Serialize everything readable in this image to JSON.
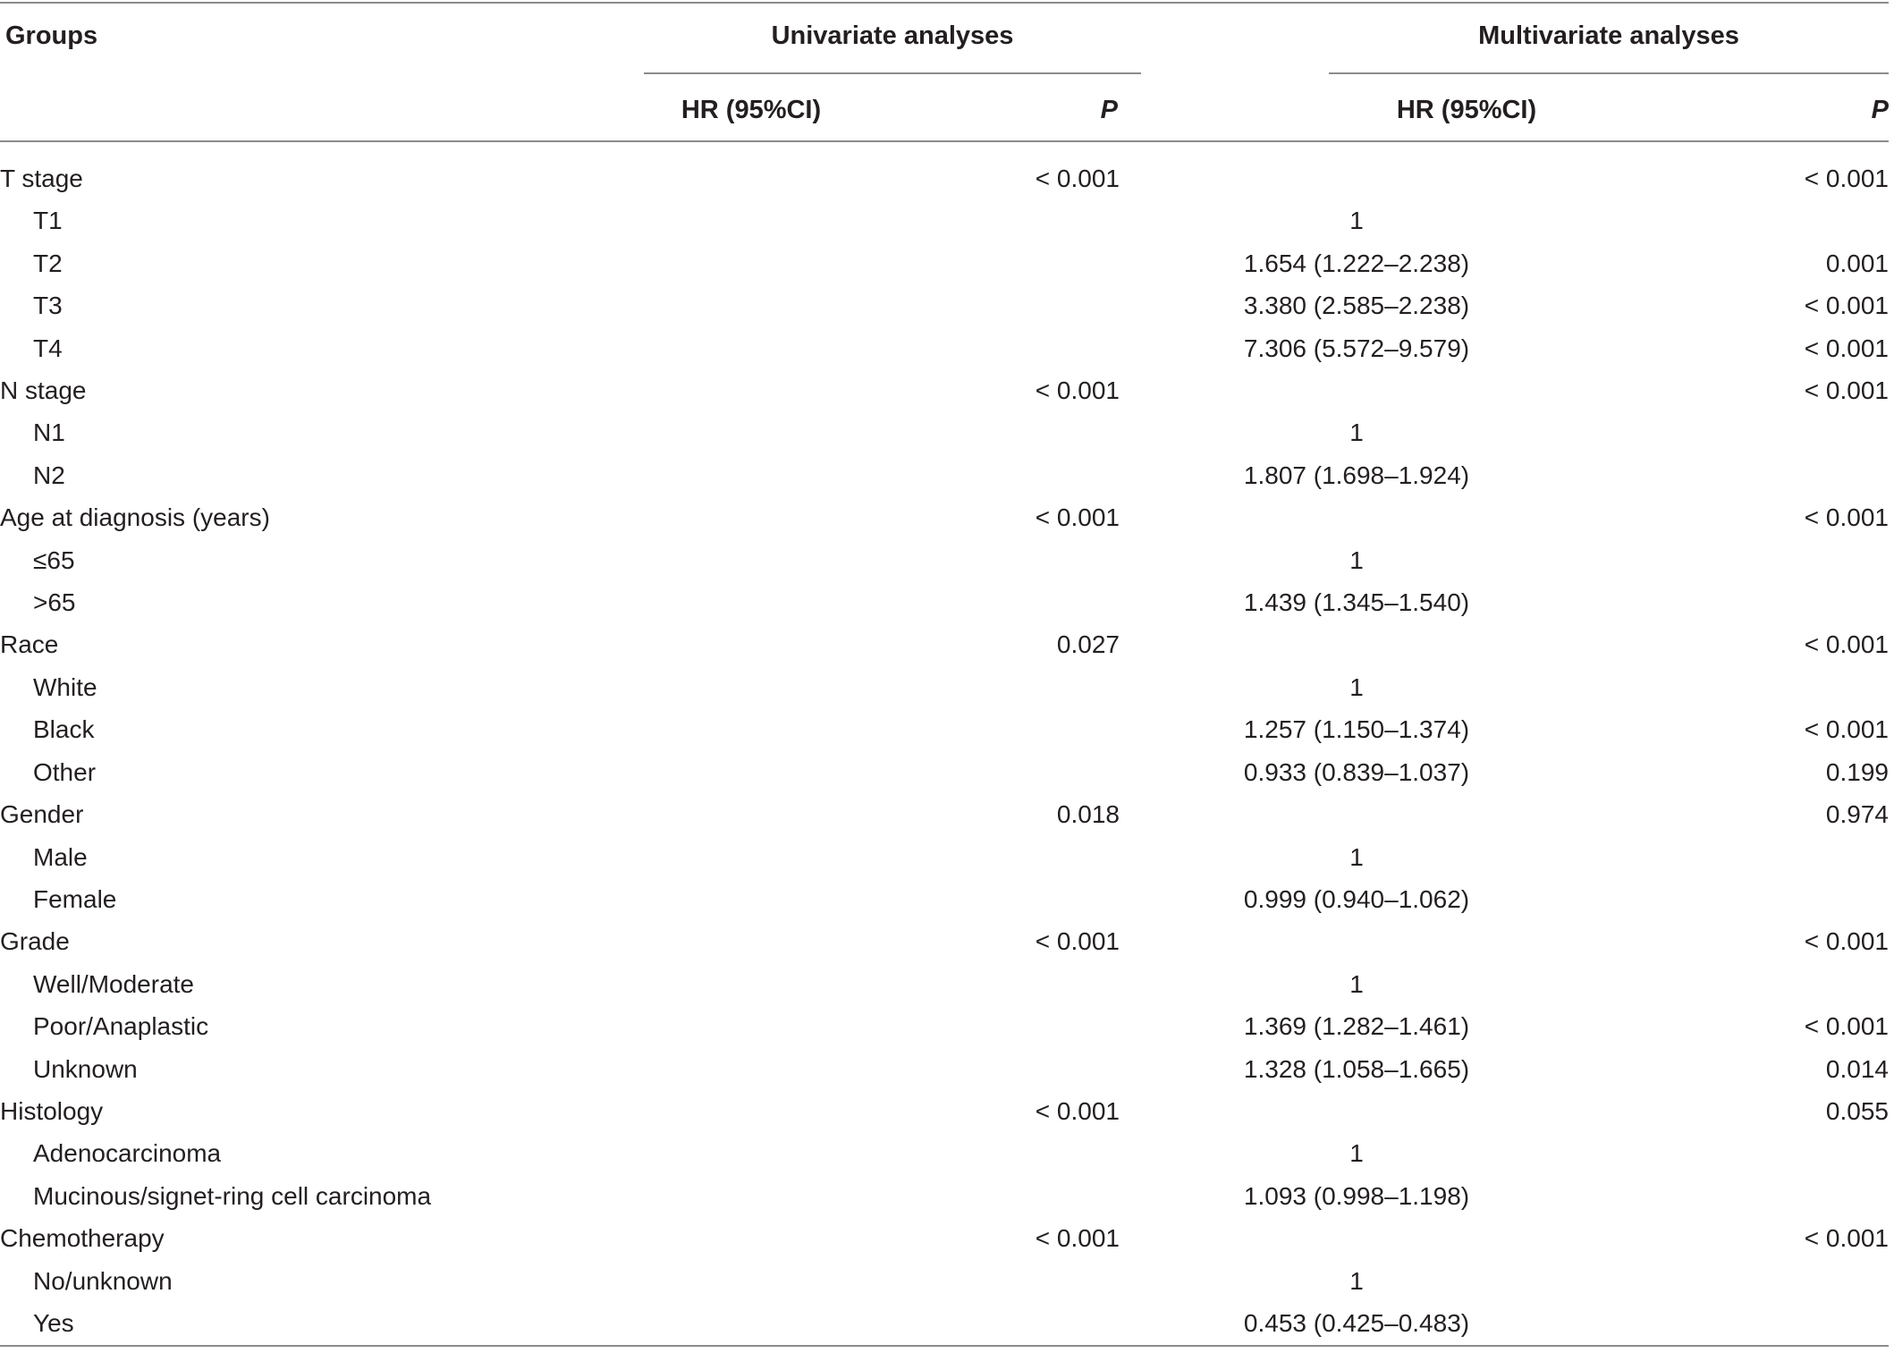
{
  "header": {
    "groups": "Groups",
    "univariate": "Univariate analyses",
    "multivariate": "Multivariate analyses",
    "hr_col": "HR (95%CI)",
    "p_col": "P"
  },
  "rows": [
    {
      "label": "T stage",
      "sub": false,
      "uhr": "",
      "up": "< 0.001",
      "mhr": "",
      "mp": "< 0.001"
    },
    {
      "label": "T1",
      "sub": true,
      "uhr": "",
      "up": "",
      "mhr": "1",
      "mp": ""
    },
    {
      "label": "T2",
      "sub": true,
      "uhr": "",
      "up": "",
      "mhr": "1.654 (1.222–2.238)",
      "mp": "0.001"
    },
    {
      "label": "T3",
      "sub": true,
      "uhr": "",
      "up": "",
      "mhr": "3.380 (2.585–2.238)",
      "mp": "< 0.001"
    },
    {
      "label": "T4",
      "sub": true,
      "uhr": "",
      "up": "",
      "mhr": "7.306 (5.572–9.579)",
      "mp": "< 0.001"
    },
    {
      "label": "N stage",
      "sub": false,
      "uhr": "",
      "up": "< 0.001",
      "mhr": "",
      "mp": "< 0.001"
    },
    {
      "label": "N1",
      "sub": true,
      "uhr": "",
      "up": "",
      "mhr": "1",
      "mp": ""
    },
    {
      "label": "N2",
      "sub": true,
      "uhr": "",
      "up": "",
      "mhr": "1.807 (1.698–1.924)",
      "mp": ""
    },
    {
      "label": "Age at diagnosis (years)",
      "sub": false,
      "uhr": "",
      "up": "< 0.001",
      "mhr": "",
      "mp": "< 0.001"
    },
    {
      "label": "≤65",
      "sub": true,
      "uhr": "",
      "up": "",
      "mhr": "1",
      "mp": ""
    },
    {
      "label": ">65",
      "sub": true,
      "uhr": "",
      "up": "",
      "mhr": "1.439 (1.345–1.540)",
      "mp": ""
    },
    {
      "label": "Race",
      "sub": false,
      "uhr": "",
      "up": "0.027",
      "mhr": "",
      "mp": "< 0.001"
    },
    {
      "label": "White",
      "sub": true,
      "uhr": "",
      "up": "",
      "mhr": "1",
      "mp": ""
    },
    {
      "label": "Black",
      "sub": true,
      "uhr": "",
      "up": "",
      "mhr": "1.257 (1.150–1.374)",
      "mp": "< 0.001"
    },
    {
      "label": "Other",
      "sub": true,
      "uhr": "",
      "up": "",
      "mhr": "0.933 (0.839–1.037)",
      "mp": "0.199"
    },
    {
      "label": "Gender",
      "sub": false,
      "uhr": "",
      "up": "0.018",
      "mhr": "",
      "mp": "0.974"
    },
    {
      "label": "Male",
      "sub": true,
      "uhr": "",
      "up": "",
      "mhr": "1",
      "mp": ""
    },
    {
      "label": "Female",
      "sub": true,
      "uhr": "",
      "up": "",
      "mhr": "0.999 (0.940–1.062)",
      "mp": ""
    },
    {
      "label": "Grade",
      "sub": false,
      "uhr": "",
      "up": "< 0.001",
      "mhr": "",
      "mp": "< 0.001"
    },
    {
      "label": "Well/Moderate",
      "sub": true,
      "uhr": "",
      "up": "",
      "mhr": "1",
      "mp": ""
    },
    {
      "label": "Poor/Anaplastic",
      "sub": true,
      "uhr": "",
      "up": "",
      "mhr": "1.369 (1.282–1.461)",
      "mp": "< 0.001"
    },
    {
      "label": "Unknown",
      "sub": true,
      "uhr": "",
      "up": "",
      "mhr": "1.328 (1.058–1.665)",
      "mp": "0.014"
    },
    {
      "label": "Histology",
      "sub": false,
      "uhr": "",
      "up": "< 0.001",
      "mhr": "",
      "mp": "0.055"
    },
    {
      "label": "Adenocarcinoma",
      "sub": true,
      "uhr": "",
      "up": "",
      "mhr": "1",
      "mp": ""
    },
    {
      "label": "Mucinous/signet-ring cell carcinoma",
      "sub": true,
      "uhr": "",
      "up": "",
      "mhr": "1.093 (0.998–1.198)",
      "mp": ""
    },
    {
      "label": "Chemotherapy",
      "sub": false,
      "uhr": "",
      "up": "< 0.001",
      "mhr": "",
      "mp": "< 0.001"
    },
    {
      "label": "No/unknown",
      "sub": true,
      "uhr": "",
      "up": "",
      "mhr": "1",
      "mp": ""
    },
    {
      "label": "Yes",
      "sub": true,
      "uhr": "",
      "up": "",
      "mhr": "0.453 (0.425–0.483)",
      "mp": ""
    }
  ]
}
